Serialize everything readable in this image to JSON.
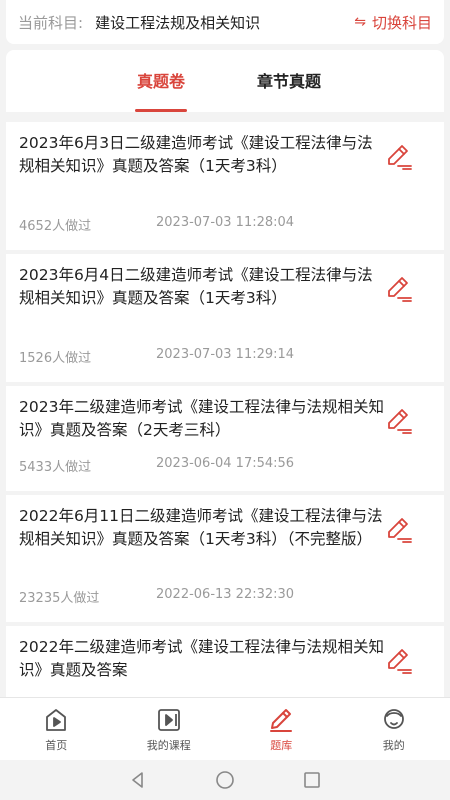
{
  "header": {
    "label": "当前科目:",
    "subject": "建设工程法规及相关知识",
    "switch_icon_text": "⇋",
    "switch_label": "切换科目"
  },
  "tabs": [
    {
      "label": "真题卷",
      "active": true
    },
    {
      "label": "章节真题",
      "active": false
    }
  ],
  "papers": [
    {
      "title": "2023年6月3日二级建造师考试《建设工程法律与法规相关知识》真题及答案（1天考3科）",
      "count": "4652人做过",
      "date": "2023-07-03 11:28:04"
    },
    {
      "title": "2023年6月4日二级建造师考试《建设工程法律与法规相关知识》真题及答案（1天考3科）",
      "count": "1526人做过",
      "date": "2023-07-03 11:29:14"
    },
    {
      "title": "2023年二级建造师考试《建设工程法律与法规相关知识》真题及答案（2天考三科）",
      "count": "5433人做过",
      "date": "2023-06-04 17:54:56"
    },
    {
      "title": "2022年6月11日二级建造师考试《建设工程法律与法规相关知识》真题及答案（1天考3科）（不完整版）",
      "count": "23235人做过",
      "date": "2022-06-13 22:32:30"
    },
    {
      "title": "2022年二级建造师考试《建设工程法律与法规相关知识》真题及答案",
      "count": "",
      "date": ""
    }
  ],
  "bottom_nav": [
    {
      "label": "首页",
      "icon": "home-play-icon",
      "active": false
    },
    {
      "label": "我的课程",
      "icon": "course-video-icon",
      "active": false
    },
    {
      "label": "题库",
      "icon": "pencil-icon",
      "active": true
    },
    {
      "label": "我的",
      "icon": "profile-icon",
      "active": false
    }
  ],
  "colors": {
    "accent": "#d9453c",
    "background": "#f3f3f3",
    "text": "#222222",
    "muted": "#9a9a9a"
  }
}
